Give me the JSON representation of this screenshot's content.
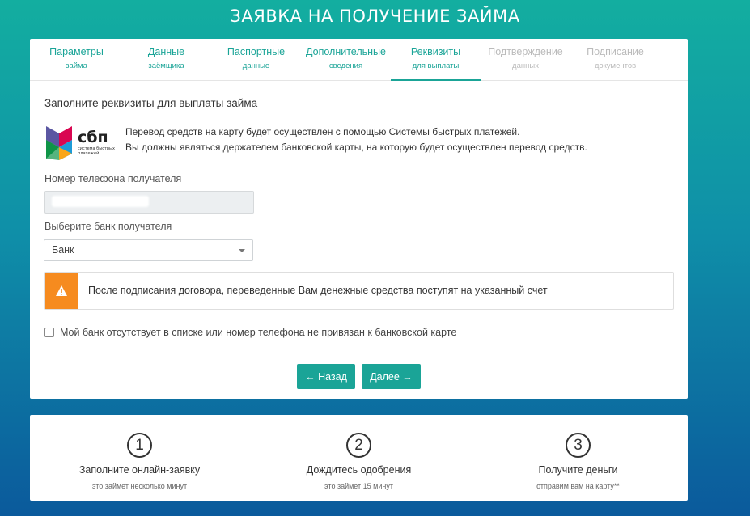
{
  "page": {
    "title": "ЗАЯВКА НА ПОЛУЧЕНИЕ ЗАЙМА"
  },
  "steps": [
    {
      "title": "Параметры",
      "sub": "займа",
      "state": "done"
    },
    {
      "title": "Данные",
      "sub": "заёмщика",
      "state": "done"
    },
    {
      "title": "Паспортные",
      "sub": "данные",
      "state": "done"
    },
    {
      "title": "Дополнительные",
      "sub": "сведения",
      "state": "done"
    },
    {
      "title": "Реквизиты",
      "sub": "для выплаты",
      "state": "active"
    },
    {
      "title": "Подтверждение",
      "sub": "данных",
      "state": "disabled"
    },
    {
      "title": "Подписание",
      "sub": "документов",
      "state": "disabled"
    }
  ],
  "form": {
    "section_title": "Заполните реквизиты для выплаты займа",
    "sbp": {
      "logo_text": "сбп",
      "logo_sub_line1": "система быстрых",
      "logo_sub_line2": "платежей",
      "line1": "Перевод средств на карту будет осуществлен с помощью Системы быстрых платежей.",
      "line2": "Вы должны являться держателем банковской карты, на которую будет осуществлен перевод средств."
    },
    "phone_label": "Номер телефона получателя",
    "phone_value": "",
    "bank_label": "Выберите банк получателя",
    "bank_selected": "Банк",
    "alert_text": "После подписания договора, переведенные Вам денежные средства поступят на указанный счет",
    "checkbox_label": "Мой банк отсутствует в списке или номер телефона не привязан к банковской карте",
    "checkbox_checked": false,
    "back_label": "← Назад",
    "next_label": "Далее →"
  },
  "how_it_works": [
    {
      "num": "1",
      "title": "Заполните онлайн-заявку",
      "sub": "это займет несколько минут"
    },
    {
      "num": "2",
      "title": "Дождитесь одобрения",
      "sub": "это займет 15 минут"
    },
    {
      "num": "3",
      "title": "Получите деньги",
      "sub": "отправим вам на карту**"
    }
  ],
  "colors": {
    "accent": "#1aa497",
    "warning": "#f68b1f",
    "disabled": "#bbbbbb"
  },
  "icons": {
    "alert": "warning-triangle-icon",
    "select": "caret-down-icon",
    "logo": "sbp-logo-icon"
  }
}
